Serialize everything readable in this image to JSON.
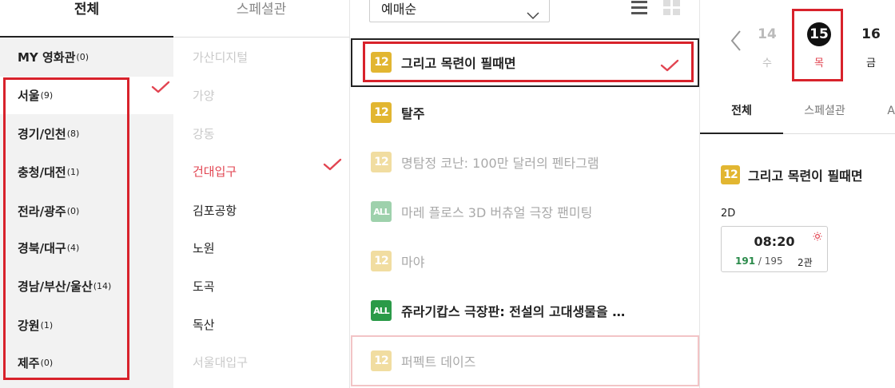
{
  "regions": {
    "tab_label": "전체",
    "items": [
      {
        "name": "MY 영화관",
        "count": "(0)"
      },
      {
        "name": "서울",
        "count": "(9)"
      },
      {
        "name": "경기/인천",
        "count": "(8)"
      },
      {
        "name": "충청/대전",
        "count": "(1)"
      },
      {
        "name": "전라/광주",
        "count": "(0)"
      },
      {
        "name": "경북/대구",
        "count": "(4)"
      },
      {
        "name": "경남/부산/울산",
        "count": "(14)"
      },
      {
        "name": "강원",
        "count": "(1)"
      },
      {
        "name": "제주",
        "count": "(0)"
      }
    ]
  },
  "theaters": {
    "tab_label": "스페셜관",
    "items": [
      "가산디지털",
      "가양",
      "강동",
      "건대입구",
      "김포공항",
      "노원",
      "도곡",
      "독산",
      "서울대입구"
    ]
  },
  "movies": {
    "sort_selected": "예매순",
    "items": [
      {
        "rating": "12",
        "title": "그리고 목련이 필때면"
      },
      {
        "rating": "12",
        "title": "탈주"
      },
      {
        "rating": "12",
        "title": "명탐정 코난: 100만 달러의 펜타그램"
      },
      {
        "rating": "ALL",
        "title": "마레 플로스 3D 버츄얼 극장 팬미팅"
      },
      {
        "rating": "12",
        "title": "마야"
      },
      {
        "rating": "ALL",
        "title": "쥬라기캅스 극장판: 전설의 고대생물을 …"
      },
      {
        "rating": "12",
        "title": "퍼펙트 데이즈"
      }
    ]
  },
  "dates": {
    "items": [
      {
        "num": "14",
        "dow": "수"
      },
      {
        "num": "15",
        "dow": "목"
      },
      {
        "num": "16",
        "dow": "금"
      }
    ]
  },
  "schedule": {
    "tabs": [
      "전체",
      "스페셜관",
      "A"
    ],
    "rating": "12",
    "movie_title": "그리고 목련이 필때면",
    "format": "2D",
    "time": "08:20",
    "seats_left": "191",
    "seats_total": "/ 195",
    "hall": "2관"
  },
  "colors": {
    "accent": "#d8222b",
    "rating12": "#e2b631",
    "ratingAll": "#2a9a48",
    "active_theater": "#e24451"
  },
  "icons": [
    "check-icon",
    "chevron-down-icon",
    "list-view-icon",
    "grid-view-icon",
    "chevron-left-icon",
    "sun-icon"
  ]
}
